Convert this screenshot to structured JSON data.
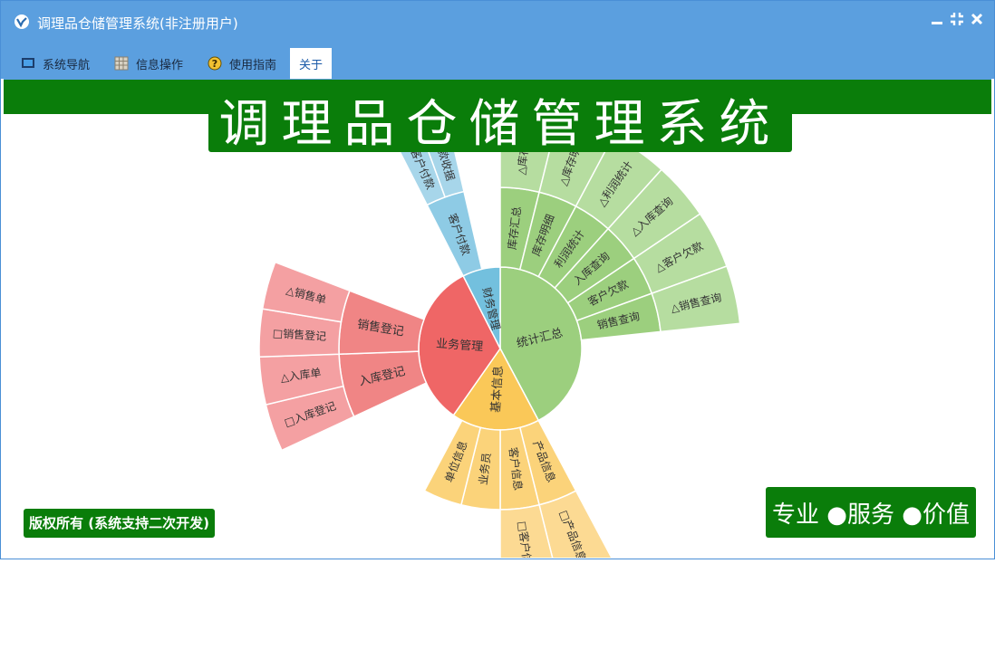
{
  "window": {
    "title": "调理品仓储管理系统(非注册用户)",
    "controls": {
      "minimize": "minimize-icon",
      "restore": "restore-icon",
      "close": "close-icon"
    }
  },
  "menu": [
    {
      "label": "系统导航",
      "icon": "monitor-icon"
    },
    {
      "label": "信息操作",
      "icon": "grid-icon"
    },
    {
      "label": "使用指南",
      "icon": "help-icon"
    },
    {
      "label": "关于",
      "icon": ""
    }
  ],
  "banner": {
    "title": "调理品仓储管理系统"
  },
  "footer": {
    "copyright": "版权所有 (系统支持二次开发)",
    "slogan": "专业 ●服务 ●价值"
  },
  "colors": {
    "titlebar": "#5b9fdf",
    "brand_green": "#0a7d0a",
    "green": "#9ccf7e",
    "green_outer": "#b6dda0",
    "red": "#ef6666",
    "red_mid": "#f08585",
    "red_outer": "#f4a0a2",
    "yellow": "#fac858",
    "yellow_mid": "#fbd37a",
    "yellow_outer": "#fcda93",
    "blue": "#73c0de",
    "blue_mid": "#8ecbe5",
    "blue_outer": "#a7d6ea"
  },
  "chart_data": {
    "type": "sunburst",
    "title": "",
    "rings": {
      "inner": [
        {
          "name": "统计汇总",
          "color": "#9ccf7e"
        },
        {
          "name": "基本信息",
          "color": "#fac858"
        },
        {
          "name": "业务管理",
          "color": "#ef6666"
        },
        {
          "name": "财务管理",
          "color": "#73c0de"
        }
      ],
      "middle": [
        {
          "name": "库存汇总",
          "parent": "统计汇总"
        },
        {
          "name": "库存明细",
          "parent": "统计汇总"
        },
        {
          "name": "利润统计",
          "parent": "统计汇总"
        },
        {
          "name": "入库查询",
          "parent": "统计汇总"
        },
        {
          "name": "客户欠款",
          "parent": "统计汇总"
        },
        {
          "name": "销售查询",
          "parent": "统计汇总"
        },
        {
          "name": "产品信息",
          "parent": "基本信息"
        },
        {
          "name": "客户信息",
          "parent": "基本信息"
        },
        {
          "name": "业务员",
          "parent": "基本信息"
        },
        {
          "name": "单位信息",
          "parent": "基本信息"
        },
        {
          "name": "入库登记",
          "parent": "业务管理"
        },
        {
          "name": "销售登记",
          "parent": "业务管理"
        },
        {
          "name": "客户付款",
          "parent": "财务管理"
        }
      ],
      "outer": [
        {
          "name": "△库存汇总",
          "parent": "库存汇总"
        },
        {
          "name": "△库存明细",
          "parent": "库存明细"
        },
        {
          "name": "△利润统计",
          "parent": "利润统计"
        },
        {
          "name": "△入库查询",
          "parent": "入库查询"
        },
        {
          "name": "△客户欠款",
          "parent": "客户欠款"
        },
        {
          "name": "△销售查询",
          "parent": "销售查询"
        },
        {
          "name": "□产品信息",
          "parent": "产品信息"
        },
        {
          "name": "□客户信息",
          "parent": "客户信息"
        },
        {
          "name": "□入库登记",
          "parent": "入库登记"
        },
        {
          "name": "△入库单",
          "parent": "入库登记"
        },
        {
          "name": "□销售登记",
          "parent": "销售登记"
        },
        {
          "name": "△销售单",
          "parent": "销售登记"
        },
        {
          "name": "□客户付款",
          "parent": "客户付款"
        },
        {
          "name": "△收款收据",
          "parent": "客户付款"
        }
      ]
    }
  }
}
